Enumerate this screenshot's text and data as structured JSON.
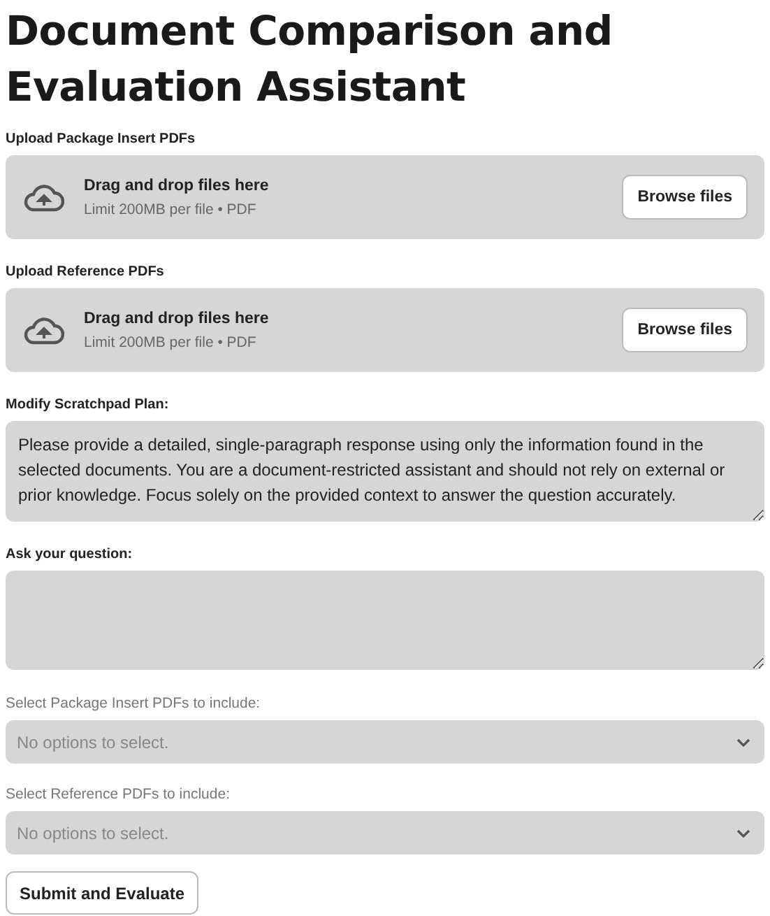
{
  "title": "Document Comparison and Evaluation Assistant",
  "uploaders": [
    {
      "label": "Upload Package Insert PDFs",
      "instruction": "Drag and drop files here",
      "limit": "Limit 200MB per file • PDF",
      "button": "Browse files"
    },
    {
      "label": "Upload Reference PDFs",
      "instruction": "Drag and drop files here",
      "limit": "Limit 200MB per file • PDF",
      "button": "Browse files"
    }
  ],
  "text_areas": [
    {
      "label": "Modify Scratchpad Plan:",
      "value": "Please provide a detailed, single-paragraph response using only the information found in the selected documents. You are a document-restricted assistant and should not rely on external or prior knowledge. Focus solely on the provided context to answer the question accurately.",
      "kind": "plan"
    },
    {
      "label": "Ask your question:",
      "kind": "question"
    }
  ],
  "selects": [
    {
      "label": "Select Package Insert PDFs to include:",
      "placeholder": "No options to select.",
      "disabled": true
    },
    {
      "label": "Select Reference PDFs to include:",
      "placeholder": "No options to select.",
      "disabled": true
    }
  ],
  "submit_button": "Submit and Evaluate"
}
